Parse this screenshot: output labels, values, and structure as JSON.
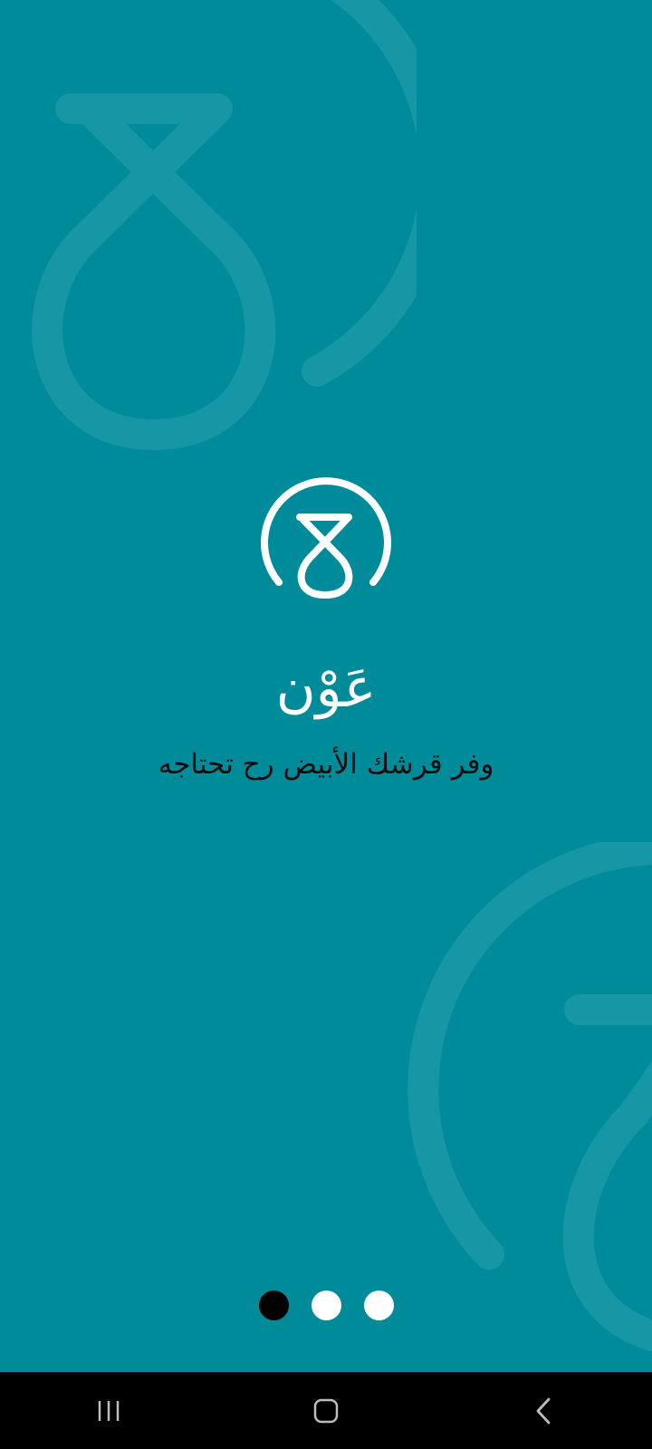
{
  "app": {
    "name": "عَوْن",
    "tagline": "وفر قرشك الأبيض رح تحتاجه"
  },
  "onboarding": {
    "page_count": 3,
    "active_page": 1
  },
  "colors": {
    "background": "#008b9a",
    "watermark": "#1797a5",
    "logo": "#ffffff",
    "tagline": "#0b0b0b",
    "dot_active": "#000000",
    "dot_inactive": "#ffffff",
    "navbar": "#000000"
  },
  "icons": {
    "logo": "ayn-ring-logo",
    "nav_recents": "recents-icon",
    "nav_home": "home-icon",
    "nav_back": "back-icon"
  }
}
